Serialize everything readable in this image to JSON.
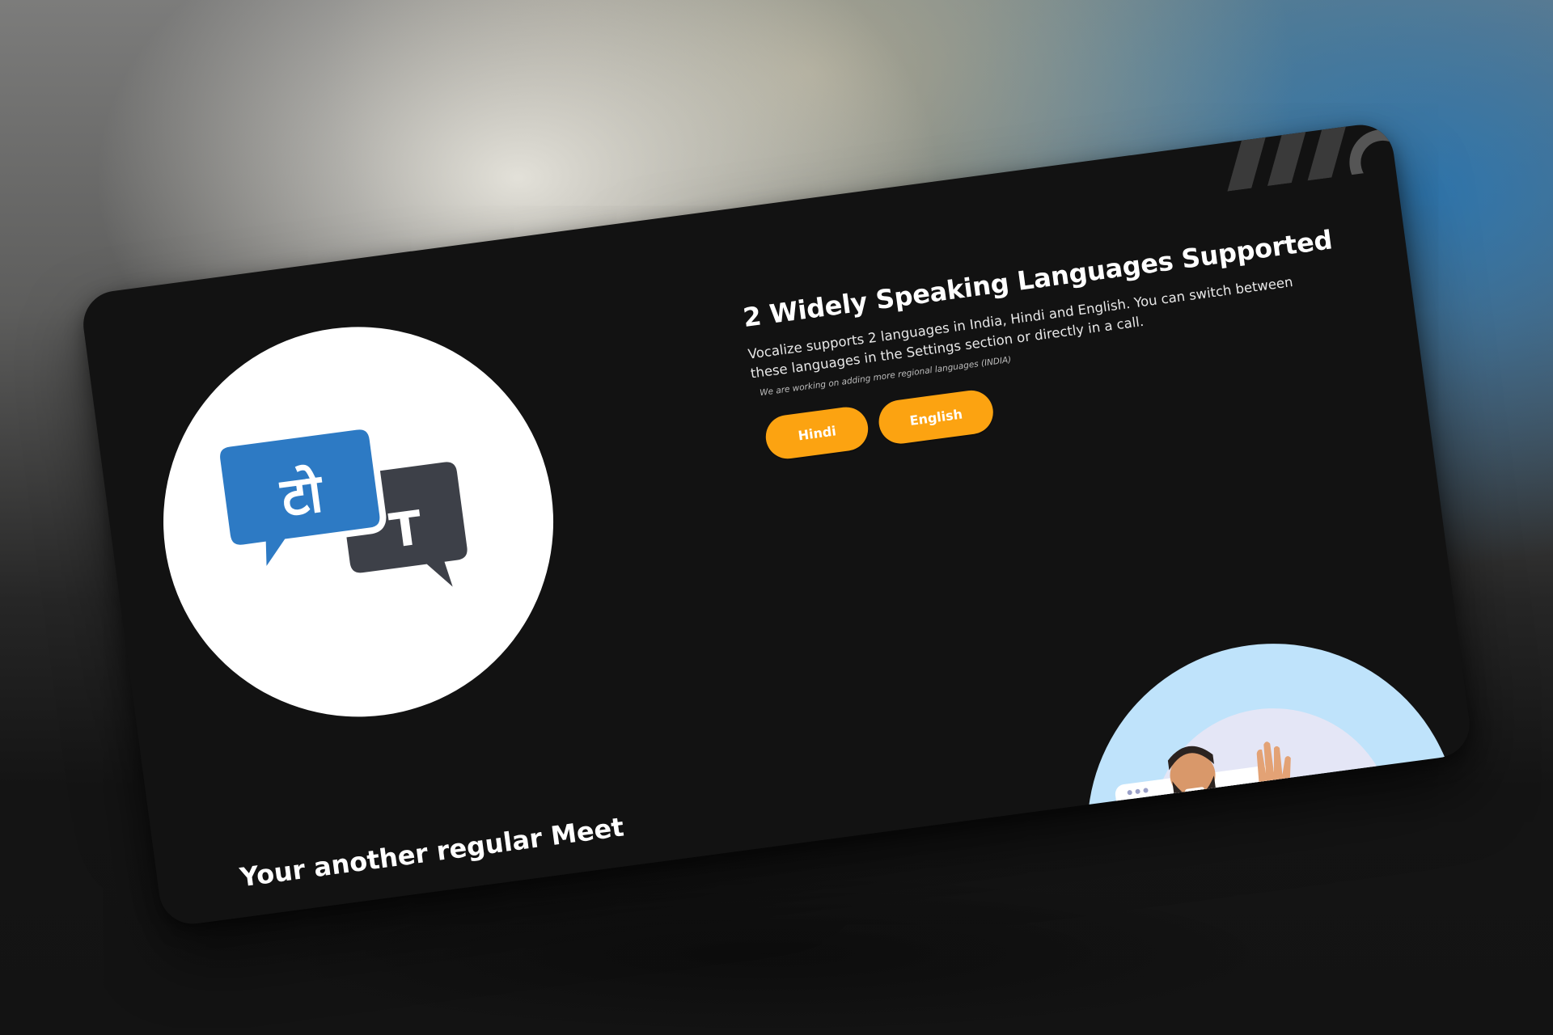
{
  "feature": {
    "title": "2 Widely Speaking Languages Supported",
    "description": "Vocalize supports 2 languages in India, Hindi and English. You can switch between these languages in the Settings section or directly in a call.",
    "note": "We are working on adding more regional languages (INDIA)",
    "buttons": [
      {
        "label": "Hindi"
      },
      {
        "label": "English"
      }
    ]
  },
  "logo": {
    "icon": "translate-bubbles-icon",
    "hindi_glyph": "टो",
    "latin_glyph": "T"
  },
  "meet": {
    "title": "Your another regular Meet",
    "illustration_icon": "waving-man-icon"
  },
  "colors": {
    "accent": "#fca311",
    "card_background": "#121212",
    "bubble_blue": "#2d7ac4",
    "bubble_dark": "#3d4048",
    "illustration_bg": "#bfe3fb"
  }
}
